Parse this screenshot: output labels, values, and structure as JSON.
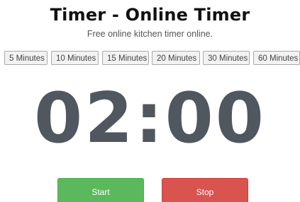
{
  "header": {
    "title": "Timer - Online Timer",
    "subtitle": "Free online kitchen timer online."
  },
  "presets": [
    {
      "label": "5 Minutes"
    },
    {
      "label": "10 Minutes"
    },
    {
      "label": "15 Minutes"
    },
    {
      "label": "20 Minutes"
    },
    {
      "label": "30 Minutes"
    },
    {
      "label": "60 Minutes"
    }
  ],
  "timer": {
    "display": "02:00"
  },
  "controls": {
    "start_label": "Start",
    "stop_label": "Stop"
  },
  "colors": {
    "start": "#5cb85c",
    "stop": "#d9534f",
    "clock": "#50575e"
  }
}
